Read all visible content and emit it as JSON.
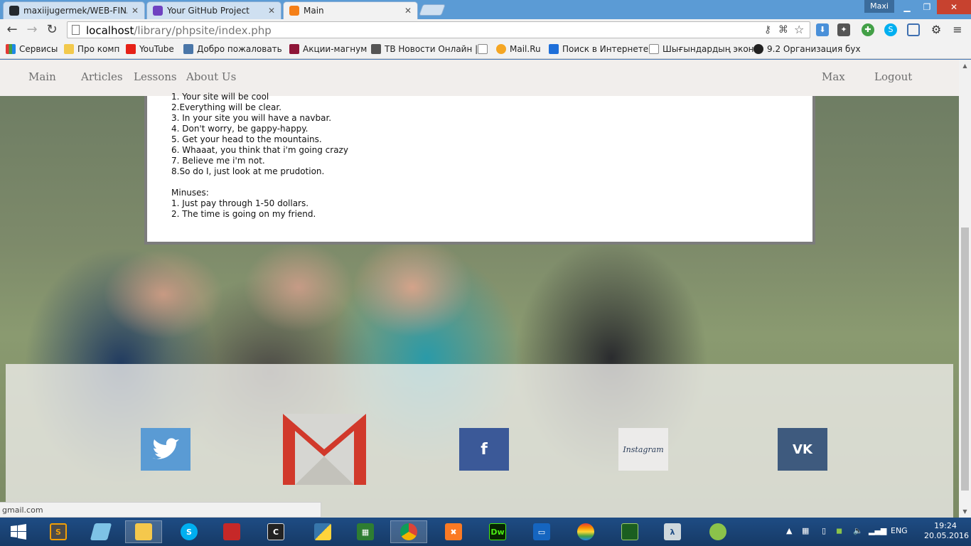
{
  "browser": {
    "tabs": [
      {
        "title": "maxiijugermek/WEB-FINA",
        "fav_color": "#24292e"
      },
      {
        "title": "Your GitHub Project",
        "fav_color": "#6f42c1"
      },
      {
        "title": "Main",
        "fav_color": "#f57f17"
      }
    ],
    "user_badge": "Maxi",
    "url_host": "localhost",
    "url_path": "/library/phpsite/index.php",
    "bookmarks": [
      "Сервисы",
      "Про комп",
      "YouTube",
      "Добро пожаловать",
      "Акции-магнум",
      "ТВ Новости Онлайн |",
      "",
      "Mail.Ru",
      "Поиск в Интернете",
      "Шығындардың эконо",
      "9.2 Организация бух"
    ],
    "status_url": "gmail.com"
  },
  "site": {
    "nav": {
      "main": "Main",
      "articles": "Articles",
      "lessons": "Lessons",
      "about": "About Us",
      "user": "Max",
      "logout": "Logout"
    },
    "content_text": "1. Your site will be cool\n2.Everything will be clear.\n3. In your site you will have a navbar.\n4. Don't worry, be gappy-happy.\n5. Get your head to the mountains.\n6. Whaaat, you think that i'm going crazy\n7. Believe me i'm not.\n8.So do I, just look at me prudotion.\n\nMinuses:\n1. Just pay through 1-50 dollars.\n2. The time is going on my friend.",
    "social": {
      "facebook_glyph": "f",
      "instagram_label": "Instagram",
      "vk_label": "VK"
    }
  },
  "taskbar": {
    "lang": "ENG",
    "time": "19:24",
    "date": "20.05.2016",
    "dw_label": "Dw"
  }
}
